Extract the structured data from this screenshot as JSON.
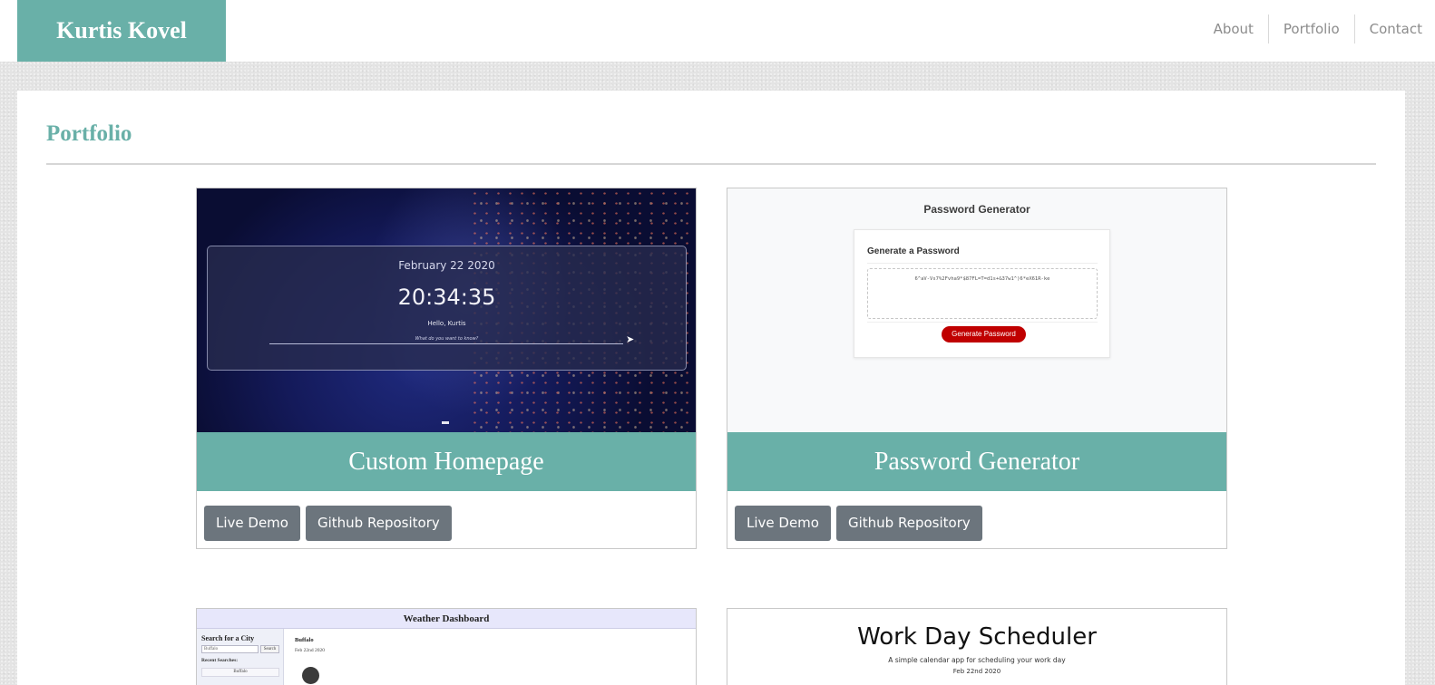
{
  "header": {
    "brand": "Kurtis Kovel",
    "nav": [
      "About",
      "Portfolio",
      "Contact"
    ]
  },
  "colors": {
    "accent": "#69b0a8",
    "button": "#6c757d",
    "page_bg": "#e4e4e4"
  },
  "main": {
    "section_title": "Portfolio",
    "projects": [
      {
        "title": "Custom Homepage",
        "buttons": [
          "Live Demo",
          "Github Repository"
        ],
        "preview": {
          "date": "February 22 2020",
          "time": "20:34:35",
          "greeting": "Hello, Kurtis",
          "search_placeholder": "What do you want to know?",
          "icon": "rocket-icon"
        }
      },
      {
        "title": "Password Generator",
        "buttons": [
          "Live Demo",
          "Github Repository"
        ],
        "preview": {
          "heading": "Password Generator",
          "card_title": "Generate a Password",
          "password": "6^aV-Vs7%2Fvha9*$87FL=T=d1s+&37w1^)6*eX61R-ke",
          "button": "Generate Password"
        }
      },
      {
        "title": "Weather Dashboard",
        "preview": {
          "heading": "Weather Dashboard",
          "search_title": "Search for a City",
          "search_value": "Buffalo",
          "search_button": "Search",
          "recent_label": "Recent Searches:",
          "recent_item": "Buffalo",
          "city": "Buffalo",
          "date": "Feb 22nd 2020",
          "icon": "weather-icon"
        }
      },
      {
        "title": "Work Day Scheduler",
        "preview": {
          "heading": "Work Day Scheduler",
          "subtitle": "A simple calendar app for scheduling your work day",
          "date": "Feb 22nd 2020"
        }
      }
    ]
  }
}
